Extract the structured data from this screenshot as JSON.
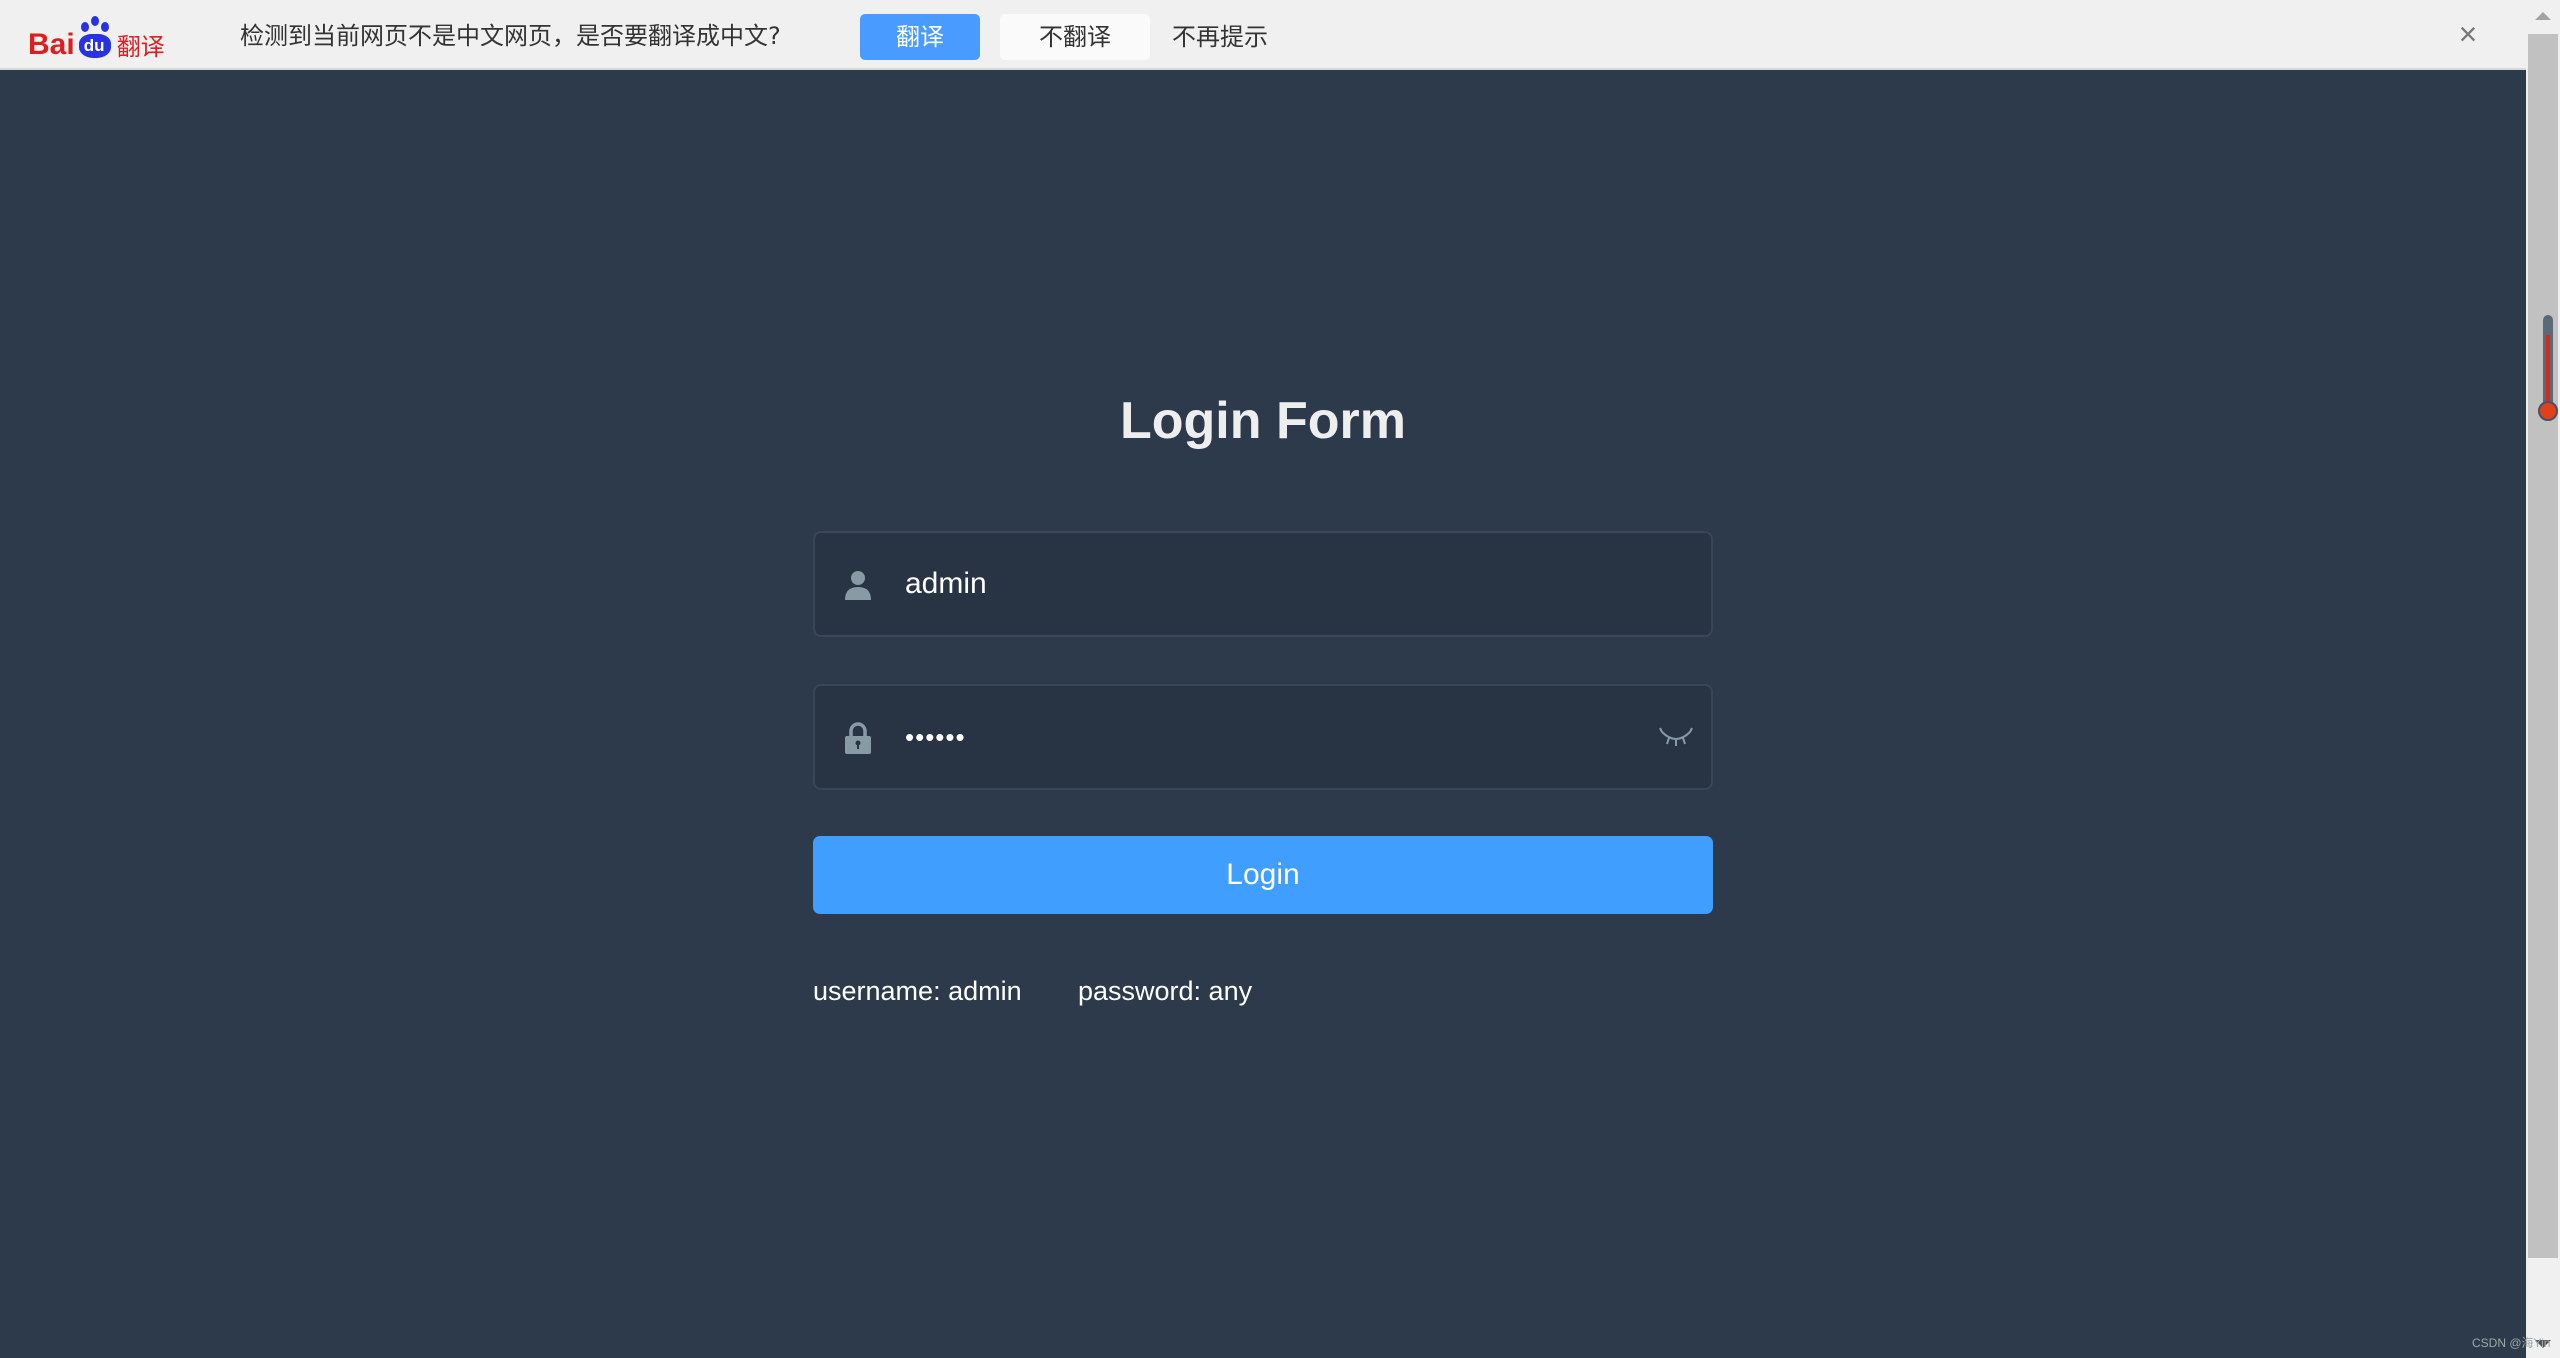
{
  "translate_bar": {
    "logo_text": "Bai du 翻译",
    "logo_bai": "Bai",
    "logo_du": "du",
    "logo_fanyi": "翻译",
    "message": "检测到当前网页不是中文网页，是否要翻译成中文?",
    "translate_label": "翻译",
    "no_translate_label": "不翻译",
    "never_label": "不再提示",
    "close_icon": "close-icon"
  },
  "login": {
    "title": "Login Form",
    "username": {
      "value": "admin",
      "icon": "user-icon"
    },
    "password": {
      "value": "••••••",
      "icon": "lock-icon",
      "toggle_icon": "eye-closed-icon"
    },
    "button_label": "Login",
    "tip_username": "username: admin",
    "tip_password": "password: any"
  },
  "watermark": "CSDN @海Yin",
  "colors": {
    "background": "#2d3a4b",
    "input_bg": "#283443",
    "primary": "#409eff",
    "translate_button": "#4a9bff"
  }
}
